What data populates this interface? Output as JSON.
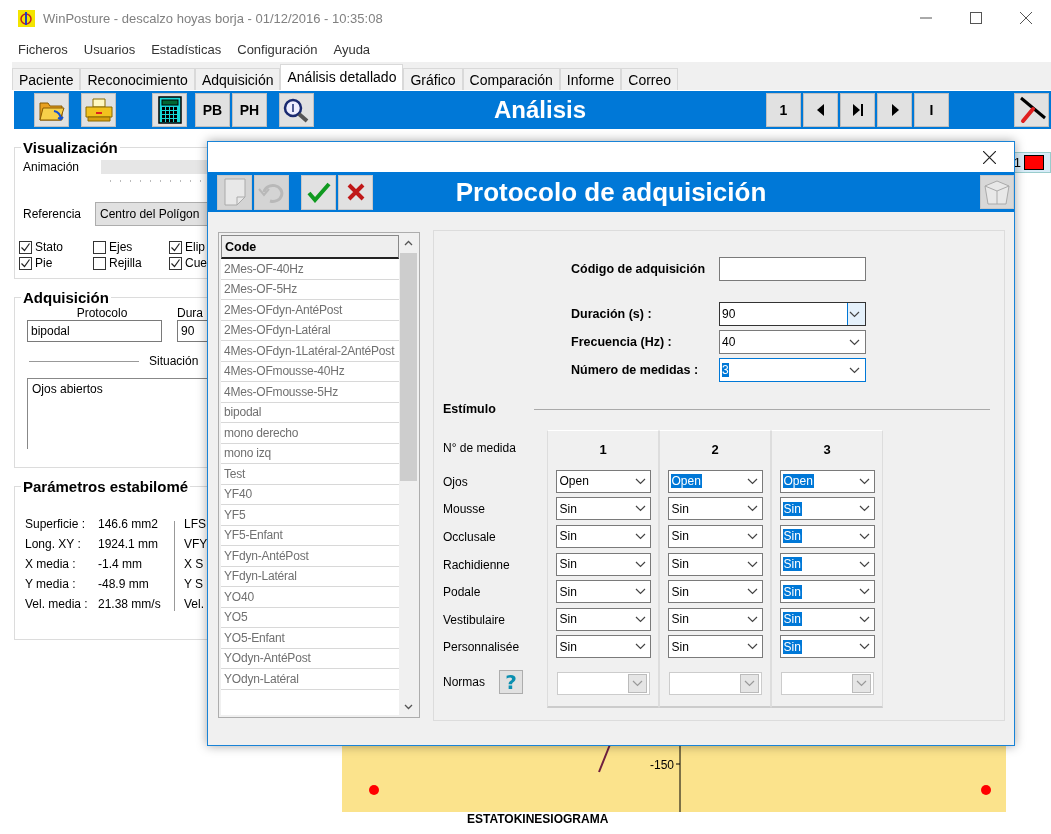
{
  "window": {
    "title": "WinPosture - descalzo hoyas borja - 01/12/2016 - 10:35:08"
  },
  "menu": [
    "Ficheros",
    "Usuarios",
    "Estadísticas",
    "Configuración",
    "Ayuda"
  ],
  "tabs": [
    {
      "label": "Paciente",
      "selected": false
    },
    {
      "label": "Reconocimiento",
      "selected": false
    },
    {
      "label": "Adquisición",
      "selected": false
    },
    {
      "label": "Análisis detallado",
      "selected": true
    },
    {
      "label": "Gráfico",
      "selected": false
    },
    {
      "label": "Comparación",
      "selected": false
    },
    {
      "label": "Informe",
      "selected": false
    },
    {
      "label": "Correo",
      "selected": false
    }
  ],
  "toolbar": {
    "title": "Análisis",
    "left_buttons": [
      {
        "kind": "folder"
      },
      {
        "kind": "printer"
      },
      {
        "kind": "calculator"
      },
      {
        "kind": "text",
        "label": "PB"
      },
      {
        "kind": "text",
        "label": "PH"
      },
      {
        "kind": "zoom"
      }
    ],
    "nav_buttons": [
      {
        "kind": "text",
        "label": "1"
      },
      {
        "kind": "prev"
      },
      {
        "kind": "step"
      },
      {
        "kind": "next"
      },
      {
        "kind": "text",
        "label": "I"
      }
    ],
    "right_buttons": [
      {
        "kind": "tool"
      }
    ]
  },
  "visualizacion": {
    "title": "Visualización",
    "animation_label": "Animación",
    "animation": {
      "level": 0
    },
    "reference_label": "Referencia",
    "reference_value": "Centro del Polígon",
    "checkboxes": [
      {
        "label": "Stato",
        "checked": true
      },
      {
        "label": "Ejes",
        "checked": false
      },
      {
        "label": "Elip",
        "checked": true
      },
      {
        "label": "Pie",
        "checked": true
      },
      {
        "label": "Rejilla",
        "checked": false
      },
      {
        "label": "Cue",
        "checked": true
      }
    ]
  },
  "adquisicion": {
    "title": "Adquisición",
    "protocol_label": "Protocolo",
    "protocol_value": "bipodal",
    "duration_label": "Dura",
    "duration_value": "90",
    "situation_label": "Situación",
    "situation_value": "Ojos abiertos"
  },
  "parametros": {
    "title": "Parámetros estabilomé",
    "rows": [
      {
        "label": "Superficie :",
        "value": "146.6 mm2",
        "column_2": "LFS"
      },
      {
        "label": "Long. XY :",
        "value": "1924.1 mm",
        "column_2": "VFY"
      },
      {
        "label": "X media :",
        "value": "-1.4 mm",
        "column_2": "X S"
      },
      {
        "label": "Y media :",
        "value": "-48.9 mm",
        "column_2": "Y S"
      },
      {
        "label": "Vel. media :",
        "value": "21.38 mm/s",
        "column_2": "Vel."
      }
    ]
  },
  "legend": {
    "label": "1",
    "color": "#ff0000"
  },
  "chart": {
    "tick_label": "-150",
    "title": "ESTATOKINESIOGRAMA"
  },
  "dialog": {
    "title": "Protocolo de adquisición",
    "buttons": [
      {
        "kind": "new",
        "disabled": true
      },
      {
        "kind": "undo",
        "disabled": true
      },
      {
        "kind": "accept",
        "disabled": false
      },
      {
        "kind": "cancel",
        "disabled": false
      }
    ],
    "list": {
      "header": "Code",
      "items": [
        "2Mes-OF-40Hz",
        "2Mes-OF-5Hz",
        "2Mes-OFdyn-AntéPost",
        "2Mes-OFdyn-Latéral",
        "4Mes-OFdyn-1Latéral-2AntéPost",
        "4Mes-OFmousse-40Hz",
        "4Mes-OFmousse-5Hz",
        "bipodal",
        "mono derecho",
        "mono izq",
        "Test",
        "YF40",
        "YF5",
        "YF5-Enfant",
        "YFdyn-AntéPost",
        "YFdyn-Latéral",
        "YO40",
        "YO5",
        "YO5-Enfant",
        "YOdyn-AntéPost",
        "YOdyn-Latéral"
      ]
    },
    "fields": [
      {
        "label": "Código de adquisición",
        "kind": "text",
        "focused": false,
        "selected": false
      },
      {
        "label": "Duración (s) :",
        "kind": "combo",
        "value": "90",
        "focused": true,
        "selected": false
      },
      {
        "label": "Frecuencia (Hz) :",
        "kind": "combo",
        "value": "40",
        "focused": false,
        "selected": false
      },
      {
        "label": "Número de medidas :",
        "kind": "combo",
        "value": "3",
        "focused": false,
        "selected": true
      }
    ],
    "stimulus": {
      "title": "Estímulo",
      "header_label": "N° de medida",
      "columns": [
        "1",
        "2",
        "3"
      ],
      "rows": [
        {
          "label": "Ojos",
          "cells": [
            {
              "value": "Open",
              "selected": false
            },
            {
              "value": "Open",
              "selected": true
            },
            {
              "value": "Open",
              "selected": true
            }
          ]
        },
        {
          "label": "Mousse",
          "cells": [
            {
              "value": "Sin",
              "selected": false
            },
            {
              "value": "Sin",
              "selected": false
            },
            {
              "value": "Sin",
              "selected": true
            }
          ]
        },
        {
          "label": "Occlusale",
          "cells": [
            {
              "value": "Sin",
              "selected": false
            },
            {
              "value": "Sin",
              "selected": false
            },
            {
              "value": "Sin",
              "selected": true
            }
          ]
        },
        {
          "label": "Rachidienne",
          "cells": [
            {
              "value": "Sin",
              "selected": false
            },
            {
              "value": "Sin",
              "selected": false
            },
            {
              "value": "Sin",
              "selected": true
            }
          ]
        },
        {
          "label": "Podale",
          "cells": [
            {
              "value": "Sin",
              "selected": false
            },
            {
              "value": "Sin",
              "selected": false
            },
            {
              "value": "Sin",
              "selected": true
            }
          ]
        },
        {
          "label": "Vestibulaire",
          "cells": [
            {
              "value": "Sin",
              "selected": false
            },
            {
              "value": "Sin",
              "selected": false
            },
            {
              "value": "Sin",
              "selected": true
            }
          ]
        },
        {
          "label": "Personnalisée",
          "cells": [
            {
              "value": "Sin",
              "selected": false
            },
            {
              "value": "Sin",
              "selected": false
            },
            {
              "value": "Sin",
              "selected": true
            }
          ]
        }
      ],
      "norms_label": "Normas",
      "help_label": "?"
    }
  }
}
